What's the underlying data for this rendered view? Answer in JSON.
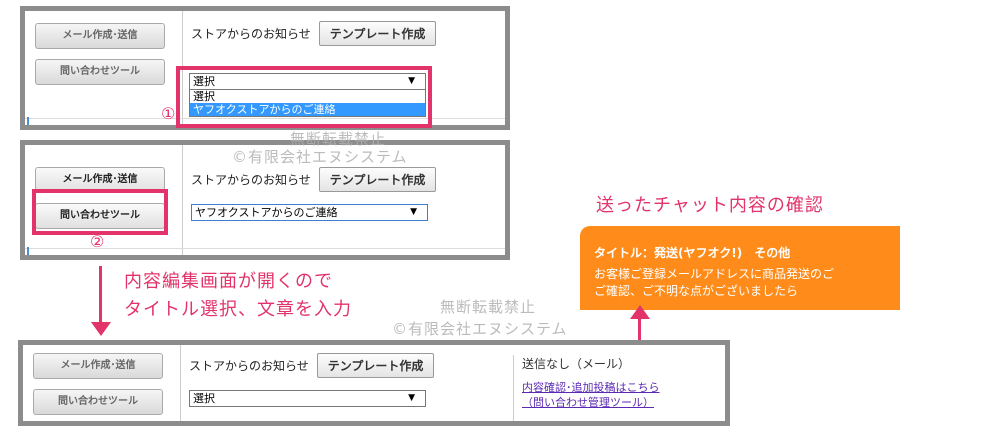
{
  "panel1": {
    "compose_btn": "メール作成･送信",
    "inquiry_btn": "問い合わせツール",
    "store_label": "ストアからのお知らせ",
    "template_btn": "テンプレート作成",
    "select_value": "選択",
    "options": [
      "選択",
      "ヤフオクストアからのご連絡"
    ],
    "step_num": "①"
  },
  "panel2": {
    "compose_btn": "メール作成･送信",
    "inquiry_btn": "問い合わせツール",
    "store_label": "ストアからのお知らせ",
    "template_btn": "テンプレート作成",
    "select_value": "ヤフオクストアからのご連絡",
    "step_num": "②"
  },
  "panel3": {
    "compose_btn": "メール作成･送信",
    "inquiry_btn": "問い合わせツール",
    "store_label": "ストアからのお知らせ",
    "template_btn": "テンプレート作成",
    "select_value": "選択",
    "status_text": "送信なし（メール）",
    "link1": "内容確認･追加投稿はこちら",
    "link2": "（問い合わせ管理ツール）"
  },
  "annotations": {
    "instruction_line1": "内容編集画面が開くので",
    "instruction_line2": "タイトル選択、文章を入力",
    "chat_heading": "送ったチャット内容の確認"
  },
  "watermark": {
    "line1": "無断転載禁止",
    "line2": "©有限会社エヌシステム"
  },
  "chat": {
    "title": "タイトル：発送(ヤフオク!)　その他",
    "body1": "お客様ご登録メールアドレスに商品発送のご",
    "body2": "ご確認、ご不明な点がございましたら"
  },
  "colors": {
    "accent": "#e2336a",
    "chat_bg": "#ff8c1a",
    "highlight": "#3399ff"
  }
}
